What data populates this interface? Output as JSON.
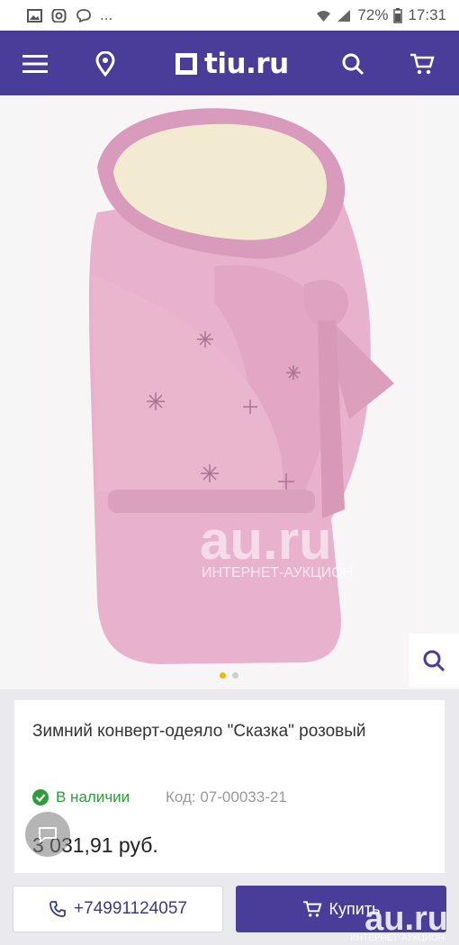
{
  "status_bar": {
    "notif_more": "...",
    "battery": "72%",
    "time": "17:31"
  },
  "nav": {
    "logo_text": "tiu.ru",
    "icons": [
      "menu-icon",
      "location-pin-icon",
      "search-icon",
      "cart-icon"
    ]
  },
  "gallery": {
    "dots": 2,
    "active_index": 0,
    "watermark": "au.ru",
    "watermark_sub": "ИНТЕРНЕТ-АУКЦИОН"
  },
  "product": {
    "title": "Зимний конверт-одеяло \"Сказка\" розовый",
    "availability": "В наличии",
    "code": "Код: 07-00033-21",
    "price": "3 031,91 руб."
  },
  "actions": {
    "phone": "+74991124057",
    "buy": "Купить"
  },
  "footer_watermark": {
    "text": "au.ru",
    "sub": "ИНТЕРНЕТ-АУКЦИОН"
  },
  "colors": {
    "brand": "#4a3d9a",
    "available": "#2e9c3a",
    "dot_active": "#f2b705"
  }
}
